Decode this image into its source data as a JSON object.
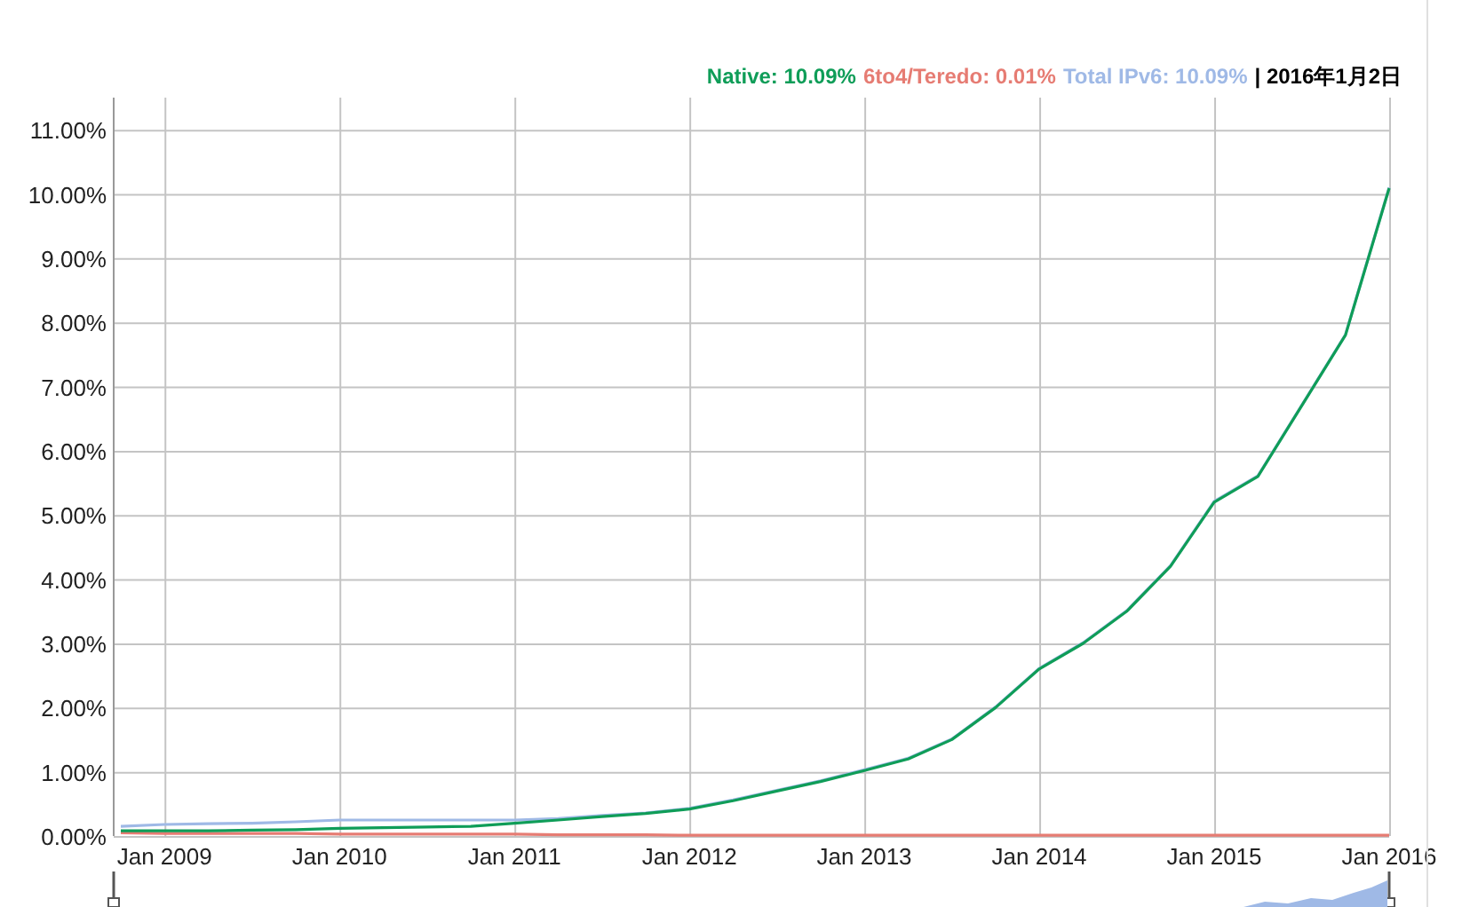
{
  "legend": {
    "items": [
      {
        "text": "Native: 10.09%",
        "color": "#0f9d58"
      },
      {
        "text": "6to4/Teredo: 0.01%",
        "color": "#e67c73"
      },
      {
        "text": "Total IPv6: 10.09%",
        "color": "#9fb9e6"
      }
    ],
    "date": "| 2016年1月2日"
  },
  "chart_data": {
    "type": "line",
    "categories": [
      null,
      "Jan 2009",
      null,
      null,
      null,
      "Jan 2010",
      null,
      null,
      null,
      "Jan 2011",
      null,
      null,
      null,
      "Jan 2012",
      null,
      null,
      null,
      "Jan 2013",
      null,
      null,
      null,
      "Jan 2014",
      null,
      null,
      null,
      "Jan 2015",
      null,
      null,
      null,
      "Jan 2016"
    ],
    "series": [
      {
        "color": "#9fb9e6",
        "values": [
          0.15,
          0.18,
          0.19,
          0.2,
          0.22,
          0.25,
          0.25,
          0.25,
          0.25,
          0.25,
          0.27,
          0.32,
          0.36,
          0.43,
          0.56,
          0.71,
          0.86,
          1.03,
          1.21,
          1.51,
          2.01,
          2.61,
          3.01,
          3.51,
          4.21,
          5.21,
          5.61,
          6.71,
          7.81,
          10.1
        ]
      },
      {
        "color": "#e67c73",
        "values": [
          0.05,
          0.04,
          0.04,
          0.04,
          0.04,
          0.03,
          0.03,
          0.03,
          0.03,
          0.03,
          0.02,
          0.02,
          0.02,
          0.01,
          0.01,
          0.01,
          0.01,
          0.01,
          0.01,
          0.01,
          0.01,
          0.01,
          0.01,
          0.01,
          0.01,
          0.01,
          0.01,
          0.01,
          0.01,
          0.01
        ]
      },
      {
        "color": "#0f9d58",
        "values": [
          0.08,
          0.08,
          0.08,
          0.09,
          0.1,
          0.12,
          0.13,
          0.14,
          0.15,
          0.2,
          0.25,
          0.3,
          0.35,
          0.42,
          0.55,
          0.7,
          0.85,
          1.02,
          1.2,
          1.5,
          2.0,
          2.6,
          3.0,
          3.5,
          4.2,
          5.2,
          5.6,
          6.7,
          7.8,
          10.09
        ]
      }
    ],
    "grid": true,
    "ylim": [
      0,
      11.5
    ],
    "yticks": [
      {
        "value": 0,
        "label": "0.00%"
      },
      {
        "value": 1,
        "label": "1.00%"
      },
      {
        "value": 2,
        "label": "2.00%"
      },
      {
        "value": 3,
        "label": "3.00%"
      },
      {
        "value": 4,
        "label": "4.00%"
      },
      {
        "value": 5,
        "label": "5.00%"
      },
      {
        "value": 6,
        "label": "6.00%"
      },
      {
        "value": 7,
        "label": "7.00%"
      },
      {
        "value": 8,
        "label": "8.00%"
      },
      {
        "value": 9,
        "label": "9.00%"
      },
      {
        "value": 10,
        "label": "10.00%"
      },
      {
        "value": 11,
        "label": "11.00%"
      }
    ]
  }
}
